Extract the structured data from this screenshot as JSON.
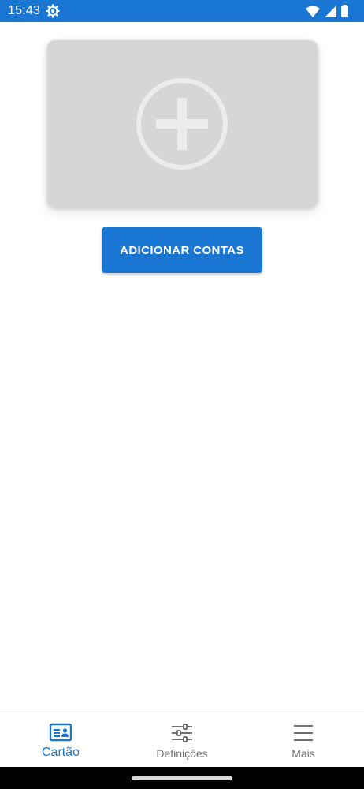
{
  "status_bar": {
    "time": "15:43",
    "icons": [
      "settings-gear-icon",
      "wifi-icon",
      "signal-icon",
      "battery-icon"
    ],
    "background_color": "#1976d2"
  },
  "card": {
    "placeholder_icon": "add-circle-icon",
    "background_color": "#d6d5d8"
  },
  "actions": {
    "add_accounts_label": "ADICIONAR CONTAS",
    "button_color": "#1976d2"
  },
  "bottom_nav": {
    "items": [
      {
        "label": "Cartão",
        "icon": "id-card-icon",
        "active": true
      },
      {
        "label": "Definições",
        "icon": "sliders-icon",
        "active": false
      },
      {
        "label": "Mais",
        "icon": "menu-icon",
        "active": false
      }
    ],
    "active_color": "#1976d2",
    "inactive_color": "#6f6f6f"
  }
}
